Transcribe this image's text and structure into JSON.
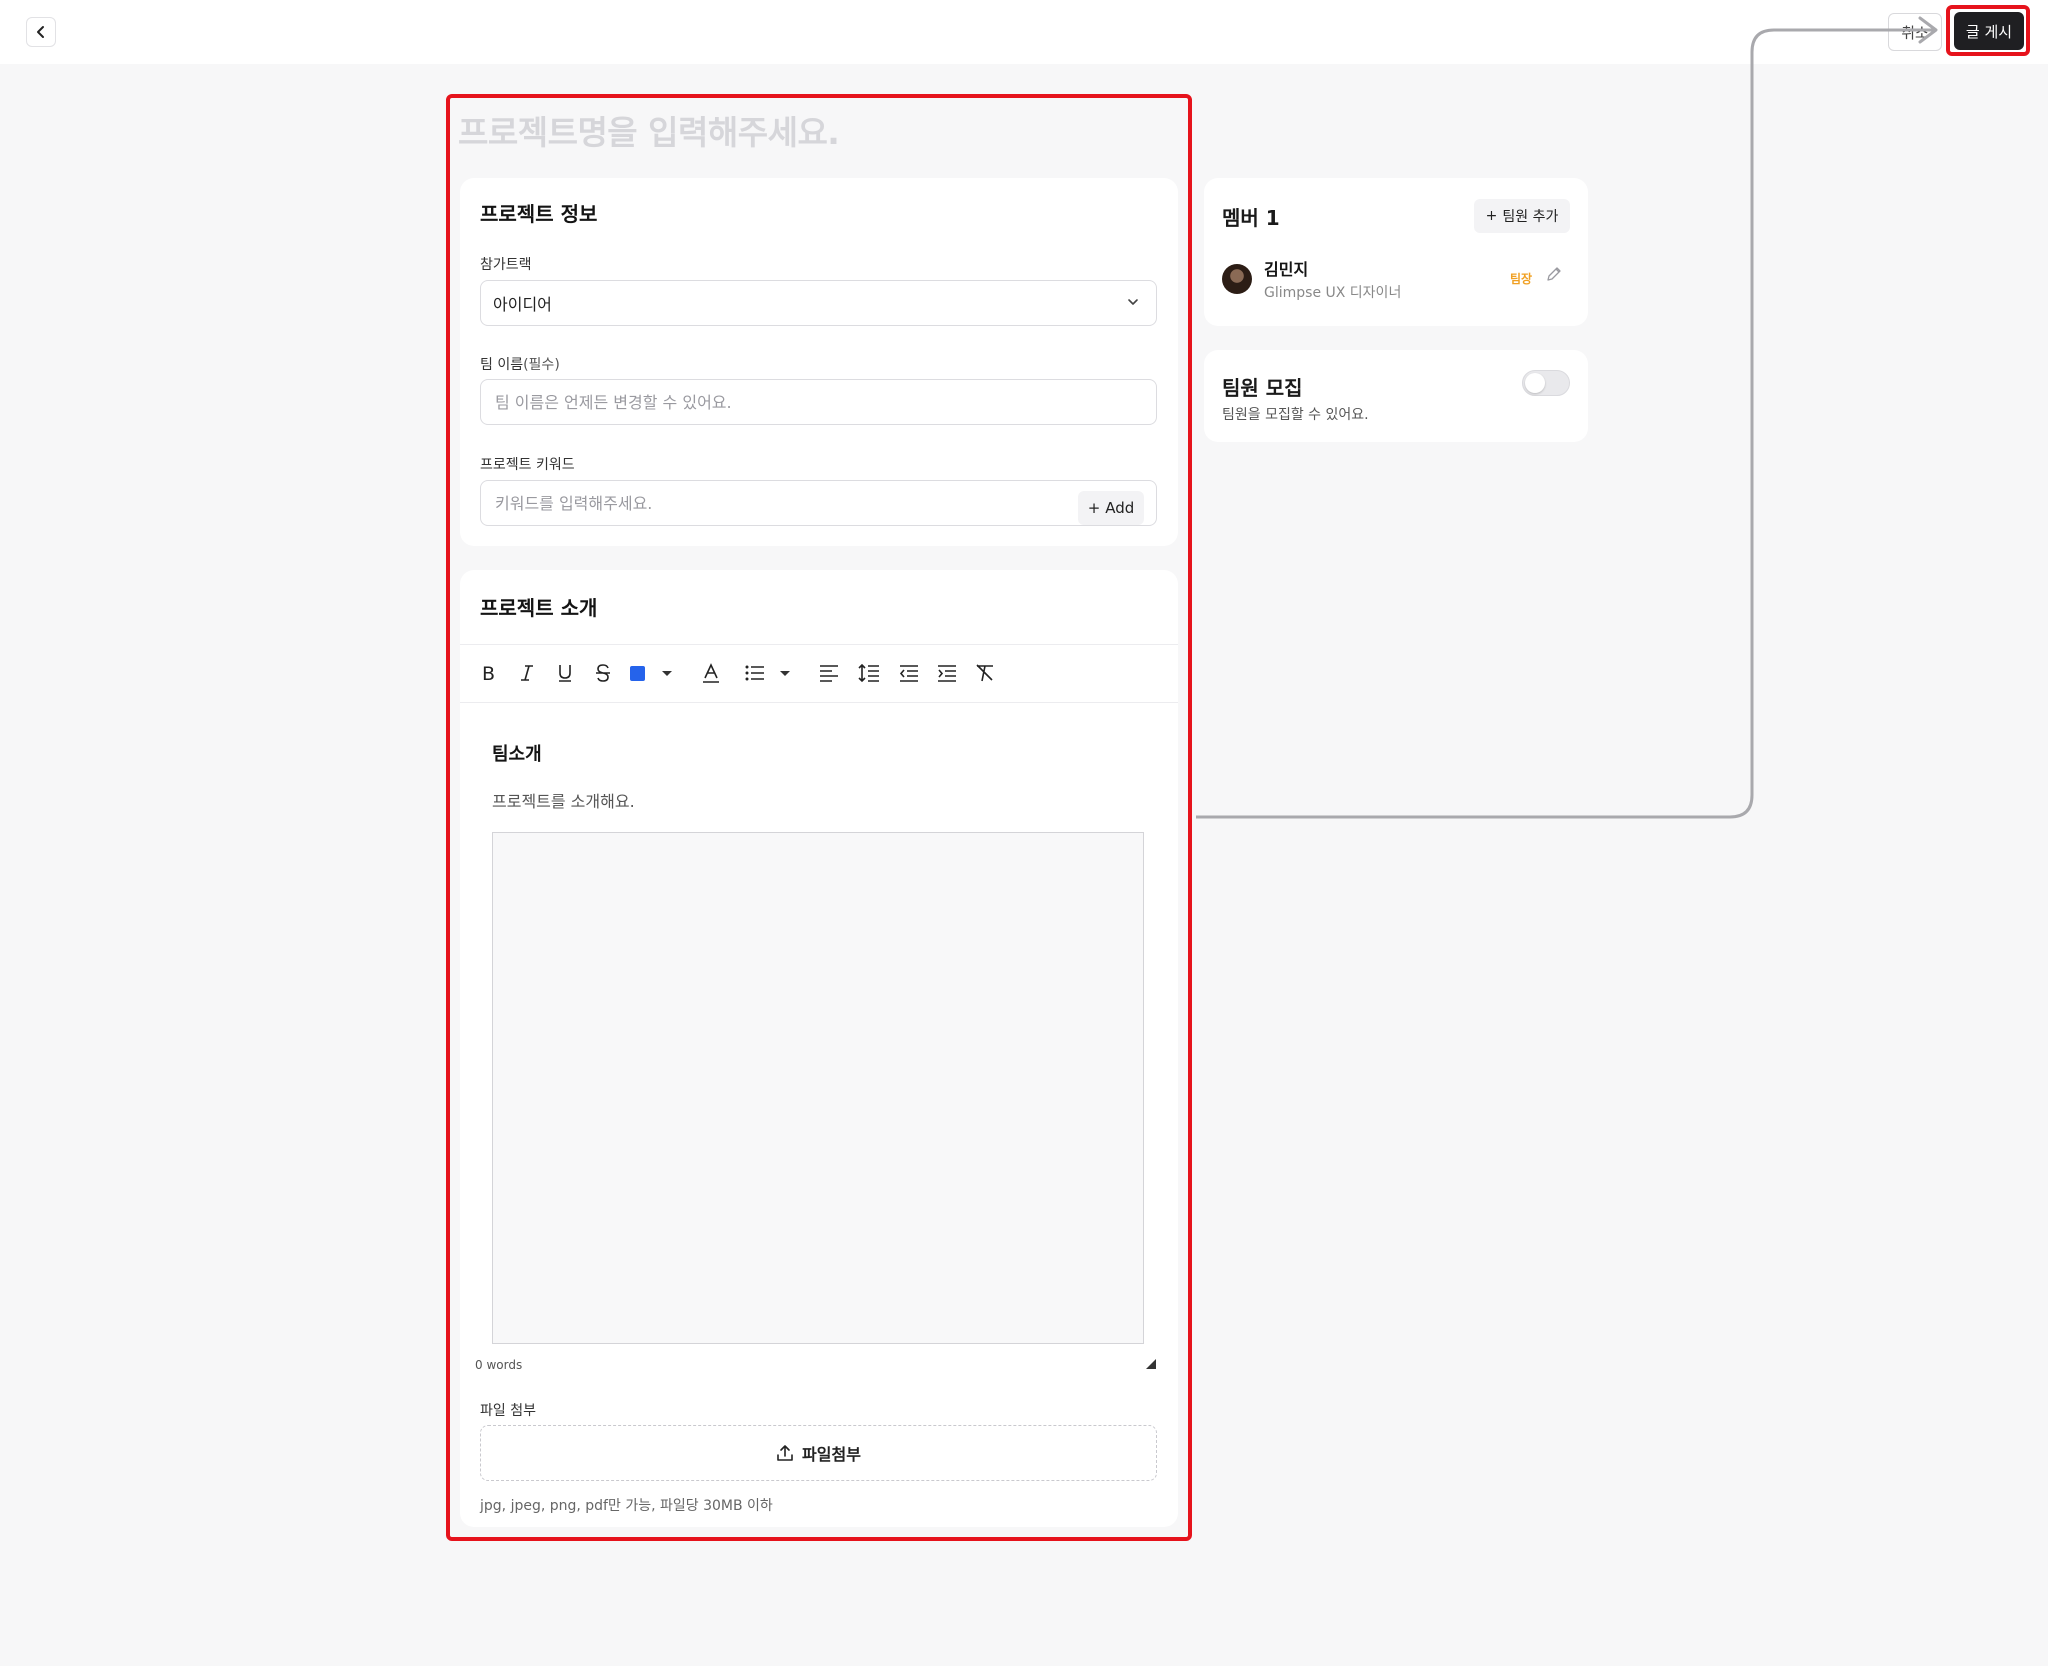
{
  "header": {
    "cancel_label": "취소",
    "post_label": "글 게시"
  },
  "project": {
    "title_placeholder": "프로젝트명을 입력해주세요."
  },
  "info": {
    "section_title": "프로젝트 정보",
    "track_label": "참가트랙",
    "track_value": "아이디어",
    "team_name_label": "팀 이름",
    "team_name_required": "(필수)",
    "team_name_placeholder": "팀 이름은 언제든 변경할 수 있어요.",
    "keyword_label": "프로젝트 키워드",
    "keyword_placeholder": "키워드를 입력해주세요.",
    "keyword_add_label": "Add"
  },
  "intro": {
    "section_title": "프로젝트 소개",
    "toolbar": [
      "bold-icon",
      "italic-icon",
      "underline-icon",
      "strikethrough-icon",
      "text-color-icon",
      "font-color-icon",
      "bullet-list-icon",
      "align-left-icon",
      "line-height-icon",
      "outdent-icon",
      "indent-icon",
      "clear-format-icon"
    ],
    "text_color": "#2563eb",
    "heading": "팀소개",
    "body_text": "프로젝트를 소개해요.",
    "word_count": "0 words",
    "attach_label": "파일 첨부",
    "attach_button": "파일첨부",
    "attach_hint": "jpg, jpeg, png, pdf만 가능, 파일당 30MB 이하"
  },
  "members": {
    "title": "멤버 1",
    "add_label": "팀원 추가",
    "list": [
      {
        "name": "김민지",
        "role": "Glimpse UX 디자이너",
        "badge": "팀장"
      }
    ]
  },
  "recruit": {
    "title": "팀원 모집",
    "description": "팀원을 모집할 수 있어요.",
    "enabled": false
  },
  "colors": {
    "highlight": "#e6131c",
    "primary_button": "#1f1f22",
    "leader_badge": "#f0a023"
  }
}
